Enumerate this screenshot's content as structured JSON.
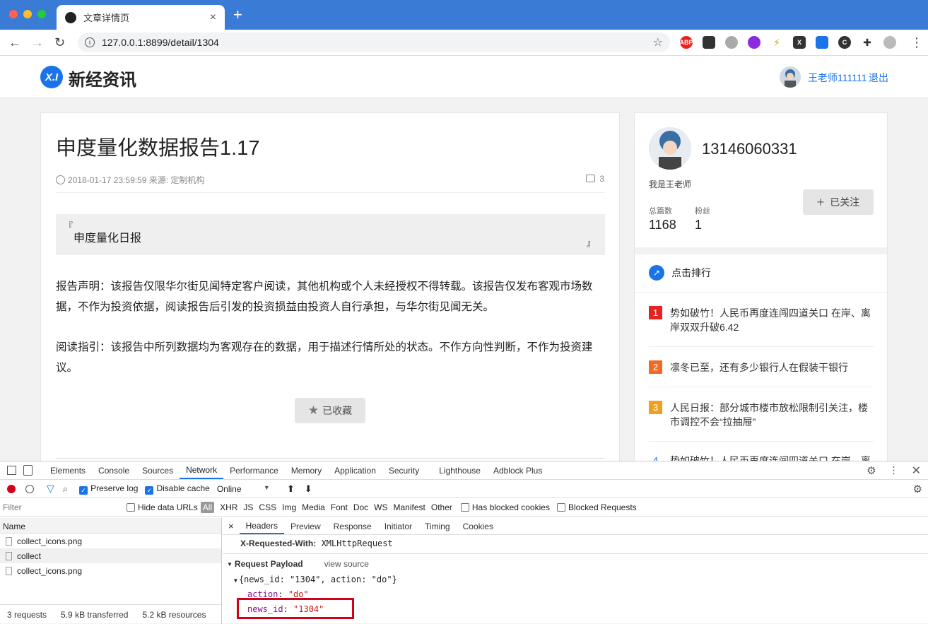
{
  "browser": {
    "tab_title": "文章详情页",
    "url": "127.0.0.1:8899/detail/1304"
  },
  "site": {
    "logo_text": "新经资讯",
    "logo_mark": "X.I",
    "user_name": "王老师111111",
    "logout": "退出"
  },
  "article": {
    "title": "申度量化数据报告1.17",
    "meta": "2018-01-17 23:59:59 来源: 定制机构",
    "comment_count": "3",
    "quote_open": "『",
    "quote_text": "申度量化日报",
    "quote_close": "』",
    "paragraph1": "报告声明：该报告仅限华尔街见闻特定客户阅读，其他机构或个人未经授权不得转载。该报告仅发布客观市场数据，不作为投资依据，阅读报告后引发的投资损益由投资人自行承担，与华尔街见闻无关。",
    "paragraph2": "阅读指引：该报告中所列数据均为客观存在的数据，用于描述行情所处的状态。不作方向性判断，不作为投资建议。",
    "collect_label": "已收藏"
  },
  "author": {
    "name": "13146060331",
    "desc": "我是王老师",
    "posts_label": "总篇数",
    "posts_value": "1168",
    "fans_label": "粉丝",
    "fans_value": "1",
    "follow_label": "已关注"
  },
  "ranking": {
    "title": "点击排行",
    "items": [
      {
        "num": "1",
        "text": "势如破竹！人民币再度连闯四道关口 在岸、离岸双双升破6.42",
        "color": "#e8231f"
      },
      {
        "num": "2",
        "text": "凛冬已至，还有多少银行人在假装干银行",
        "color": "#f06a25"
      },
      {
        "num": "3",
        "text": "人民日报：部分城市楼市放松限制引关注，楼市调控不会“拉抽屉”",
        "color": "#f0a020"
      },
      {
        "num": "4",
        "text": "势如破竹！人民币再度连闯四道关口 在岸、离",
        "color": "#1a73e8"
      }
    ]
  },
  "devtools": {
    "tabs": [
      "Elements",
      "Console",
      "Sources",
      "Network",
      "Performance",
      "Memory",
      "Application",
      "Security",
      "Lighthouse",
      "Adblock Plus"
    ],
    "active_tab": "Network",
    "preserve_log": "Preserve log",
    "disable_cache": "Disable cache",
    "throttle": "Online",
    "filter_placeholder": "Filter",
    "hide_data_urls": "Hide data URLs",
    "types": [
      "All",
      "XHR",
      "JS",
      "CSS",
      "Img",
      "Media",
      "Font",
      "Doc",
      "WS",
      "Manifest",
      "Other"
    ],
    "has_blocked_cookies": "Has blocked cookies",
    "blocked_requests": "Blocked Requests",
    "name_header": "Name",
    "requests": [
      "collect_icons.png",
      "collect",
      "collect_icons.png"
    ],
    "summary": [
      "3 requests",
      "5.9 kB transferred",
      "5.2 kB resources"
    ],
    "detail_tabs": [
      "Headers",
      "Preview",
      "Response",
      "Initiator",
      "Timing",
      "Cookies"
    ],
    "header_key": "X-Requested-With:",
    "header_val": "XMLHttpRequest",
    "payload_title": "Request Payload",
    "view_source": "view source",
    "payload_obj": "{news_id: \"1304\", action: \"do\"}",
    "action_key": "action",
    "action_val": "\"do\"",
    "news_id_key": "news_id",
    "news_id_val": "\"1304\""
  }
}
